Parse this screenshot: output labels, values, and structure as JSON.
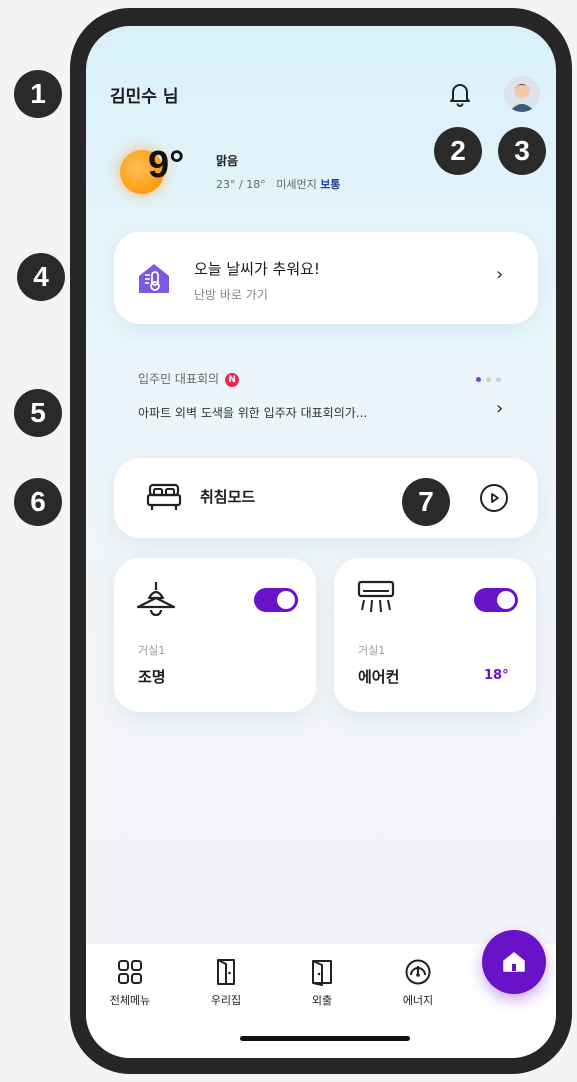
{
  "markers": [
    "1",
    "2",
    "3",
    "4",
    "5",
    "6",
    "7"
  ],
  "header": {
    "username": "김민수 님",
    "bell_icon": "bell-icon",
    "avatar": "user-avatar"
  },
  "weather": {
    "temperature": "9°",
    "condition": "맑음",
    "high_low": "23° / 18°",
    "dust_label": "미세먼지",
    "dust_status": "보통"
  },
  "heating_card": {
    "title": "오늘 날씨가 추워요!",
    "subtitle": "난방 바로 가기"
  },
  "notice": {
    "label": "입주민 대표회의",
    "badge": "N",
    "text": "아파트 외벽 도색을 위한 입주자 대표회의가...",
    "page_dots": 3,
    "active_dot": 1
  },
  "mode": {
    "label": "취침모드"
  },
  "devices": [
    {
      "room": "거실1",
      "name": "조명",
      "on": true,
      "icon": "lamp-icon"
    },
    {
      "room": "거실1",
      "name": "에어컨",
      "on": true,
      "value": "18°",
      "icon": "air-conditioner-icon"
    }
  ],
  "nav": {
    "items": [
      {
        "label": "전체메뉴",
        "icon": "grid-icon"
      },
      {
        "label": "우리집",
        "icon": "door-icon"
      },
      {
        "label": "외출",
        "icon": "exit-icon"
      },
      {
        "label": "에너지",
        "icon": "gauge-icon"
      }
    ],
    "fab_icon": "home-icon"
  },
  "colors": {
    "accent": "#6a12c8",
    "dust_status": "#1f3e9e",
    "badge": "#e8294a"
  }
}
